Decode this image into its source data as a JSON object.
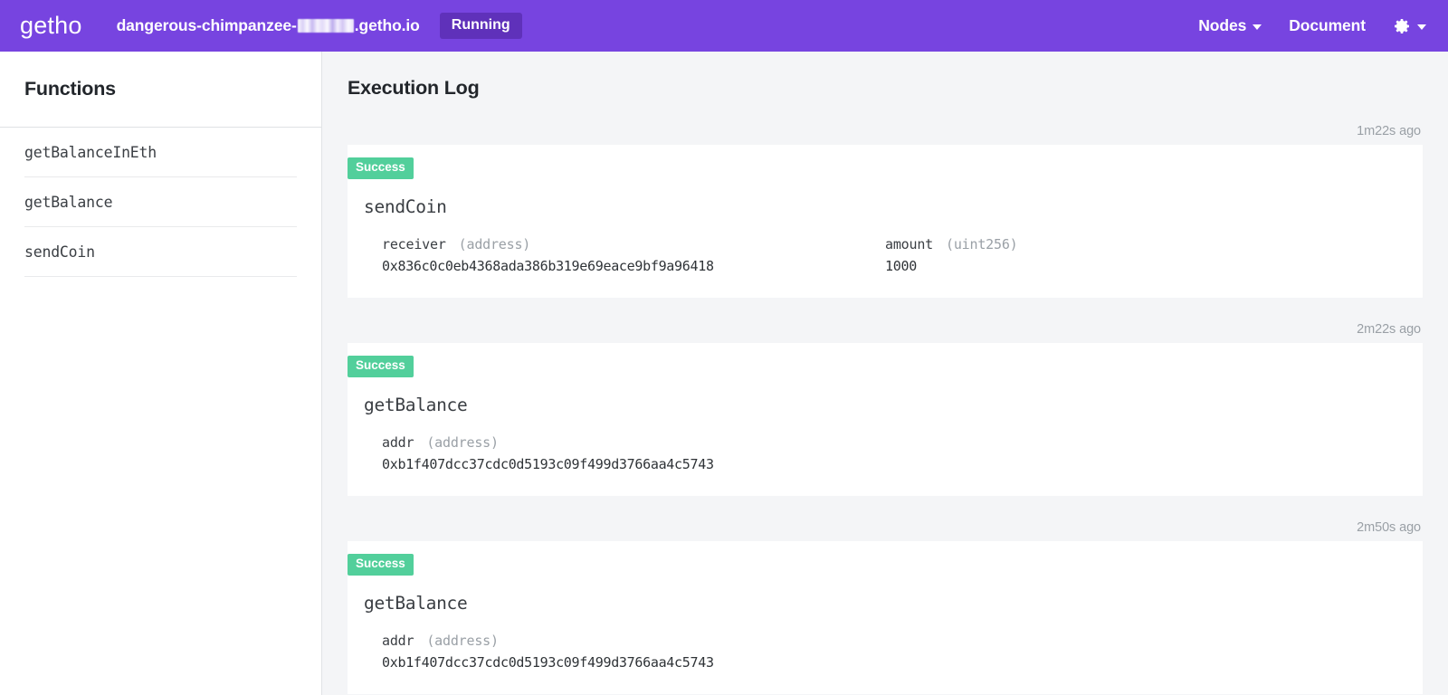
{
  "header": {
    "brand": "getho",
    "site_url_prefix": "dangerous-chimpanzee-",
    "site_url_suffix": ".getho.io",
    "status_badge": "Running",
    "nav": [
      {
        "label": "Nodes",
        "has_caret": true,
        "icon": null
      },
      {
        "label": "Document",
        "has_caret": false,
        "icon": null
      },
      {
        "label": "",
        "has_caret": true,
        "icon": "gear-icon"
      }
    ],
    "accent_color": "#7744e0",
    "badge_color": "#5f31ba"
  },
  "sidebar": {
    "title": "Functions",
    "functions": [
      {
        "name": "getBalanceInEth"
      },
      {
        "name": "getBalance"
      },
      {
        "name": "sendCoin"
      }
    ]
  },
  "main": {
    "title": "Execution Log",
    "success_color": "#52cf9b",
    "entries": [
      {
        "timestamp": "1m22s ago",
        "status": "Success",
        "function": "sendCoin",
        "params": [
          {
            "name": "receiver",
            "type": "(address)",
            "value": "0x836c0c0eb4368ada386b319e69eace9bf9a96418"
          },
          {
            "name": "amount",
            "type": "(uint256)",
            "value": "1000"
          }
        ]
      },
      {
        "timestamp": "2m22s ago",
        "status": "Success",
        "function": "getBalance",
        "params": [
          {
            "name": "addr",
            "type": "(address)",
            "value": "0xb1f407dcc37cdc0d5193c09f499d3766aa4c5743"
          }
        ]
      },
      {
        "timestamp": "2m50s ago",
        "status": "Success",
        "function": "getBalance",
        "params": [
          {
            "name": "addr",
            "type": "(address)",
            "value": "0xb1f407dcc37cdc0d5193c09f499d3766aa4c5743"
          }
        ]
      }
    ]
  }
}
